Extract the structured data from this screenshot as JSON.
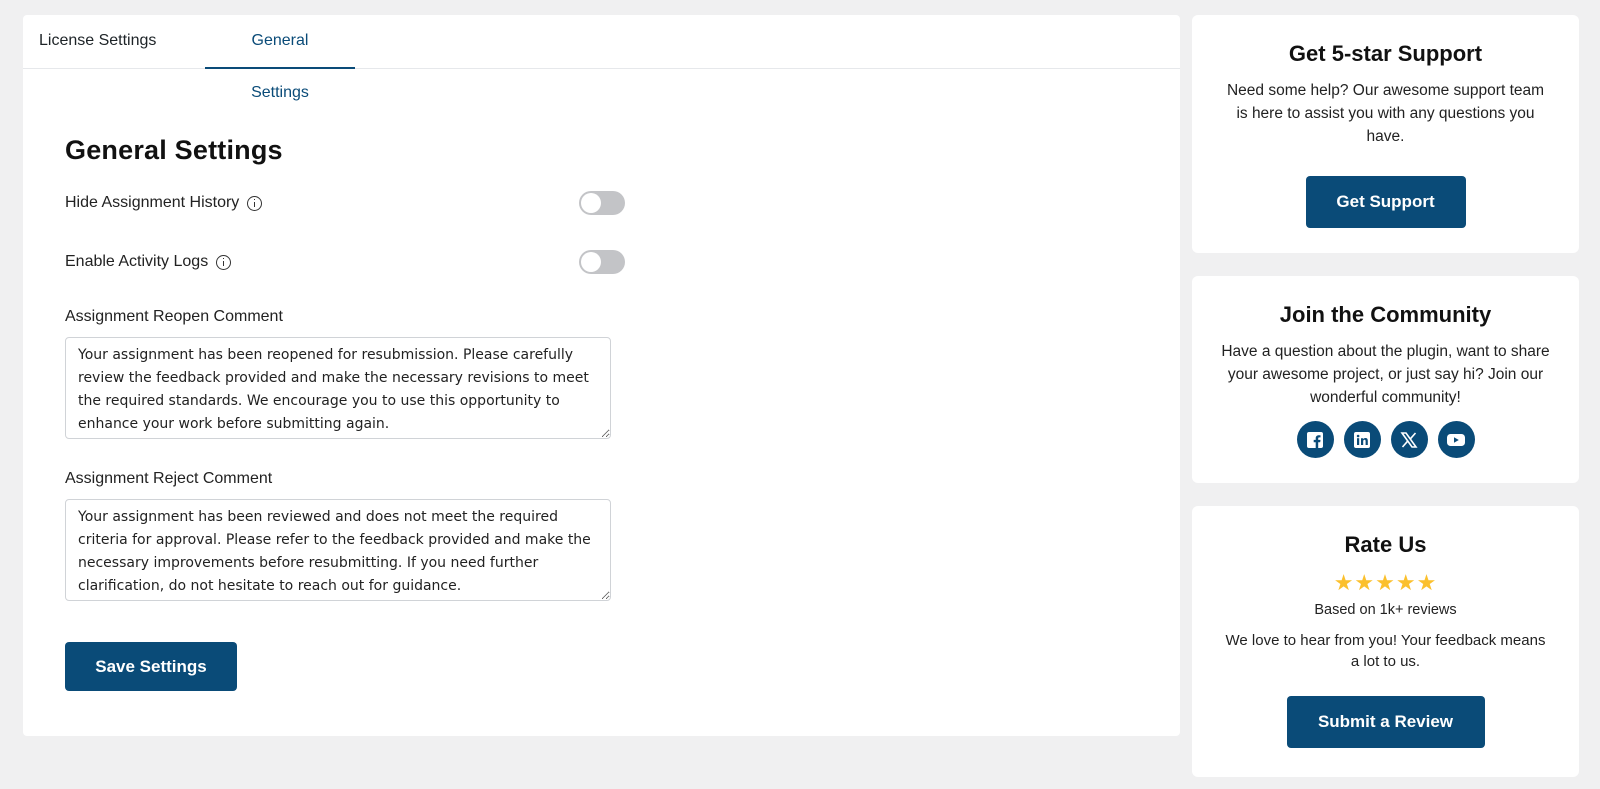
{
  "tabs": [
    {
      "label": "License Settings",
      "active": false
    },
    {
      "label": "General Settings",
      "active": true
    }
  ],
  "general": {
    "title": "General Settings",
    "hide_history_label": "Hide Assignment History",
    "hide_history_enabled": false,
    "activity_logs_label": "Enable Activity Logs",
    "activity_logs_enabled": false,
    "reopen_label": "Assignment Reopen Comment",
    "reopen_value": "Your assignment has been reopened for resubmission. Please carefully review the feedback provided and make the necessary revisions to meet the required standards. We encourage you to use this opportunity to enhance your work before submitting again.",
    "reject_label": "Assignment Reject Comment",
    "reject_value": "Your assignment has been reviewed and does not meet the required criteria for approval. Please refer to the feedback provided and make the necessary improvements before resubmitting. If you need further clarification, do not hesitate to reach out for guidance.",
    "save_label": "Save Settings"
  },
  "support": {
    "title": "Get 5-star Support",
    "text": "Need some help? Our awesome support team is here to assist you with any questions you have.",
    "button": "Get Support"
  },
  "community": {
    "title": "Join the Community",
    "text": "Have a question about the plugin, want to share your awesome project, or just say hi? Join our wonderful community!",
    "icons": [
      "facebook-icon",
      "linkedin-icon",
      "x-icon",
      "youtube-icon"
    ]
  },
  "rate": {
    "title": "Rate Us",
    "rating": 5,
    "stars": "★★★★★",
    "based_on": "Based on 1k+ reviews",
    "text": "We love to hear from you! Your feedback means a lot to us.",
    "button": "Submit a Review"
  },
  "colors": {
    "accent": "#0a4b78",
    "star": "#fbc02d",
    "background": "#f0f0f1"
  }
}
